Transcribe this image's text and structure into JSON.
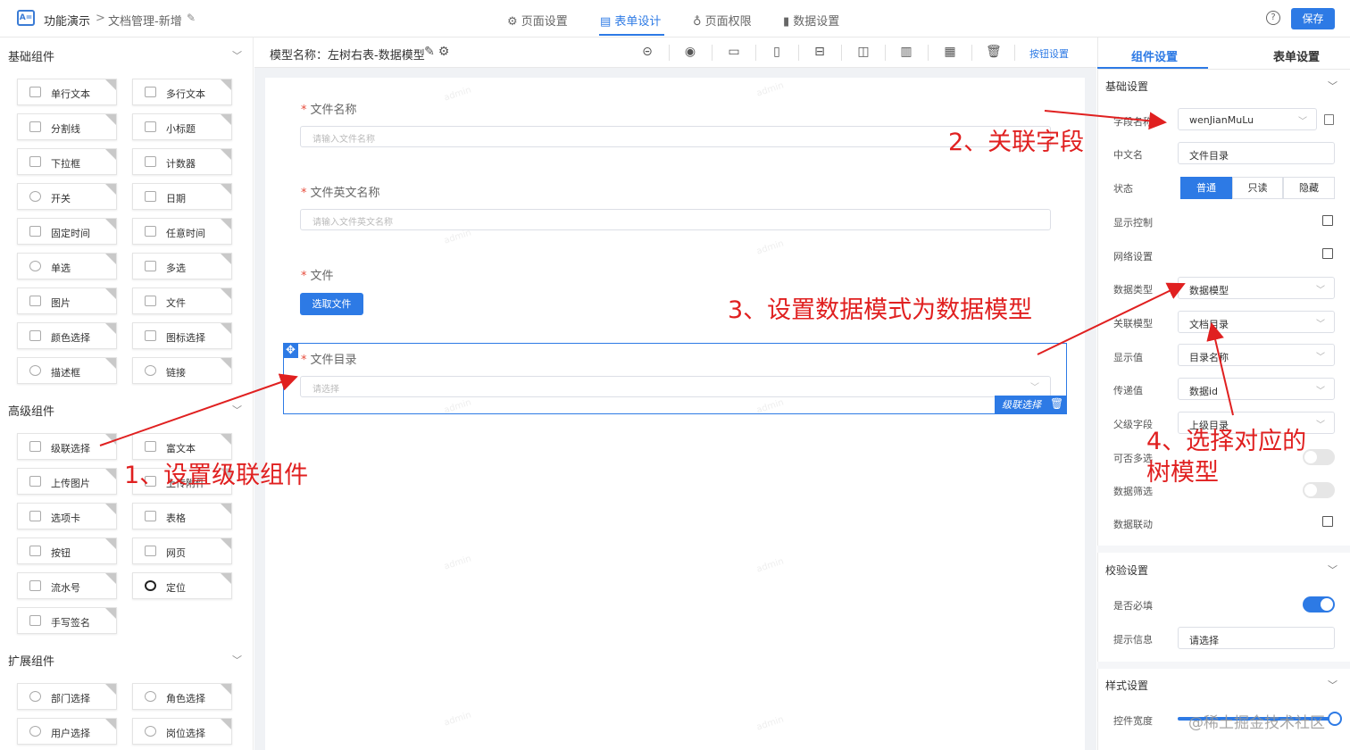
{
  "header": {
    "crumb_root": "功能演示",
    "crumb_sep": ">",
    "crumb_current": "文档管理-新增",
    "tabs": [
      "页面设置",
      "表单设计",
      "页面权限",
      "数据设置"
    ],
    "help": "?",
    "save_label": "保存"
  },
  "left": {
    "basic_title": "基础组件",
    "advanced_title": "高级组件",
    "extended_title": "扩展组件",
    "basic": [
      "单行文本",
      "多行文本",
      "分割线",
      "小标题",
      "下拉框",
      "计数器",
      "开关",
      "日期",
      "固定时间",
      "任意时间",
      "单选",
      "多选",
      "图片",
      "文件",
      "颜色选择",
      "图标选择",
      "描述框",
      "链接"
    ],
    "advanced": [
      "级联选择",
      "富文本",
      "上传图片",
      "上传附件",
      "选项卡",
      "表格",
      "按钮",
      "网页",
      "流水号",
      "定位",
      "手写签名"
    ],
    "extended": [
      "部门选择",
      "角色选择",
      "用户选择",
      "岗位选择"
    ]
  },
  "toolbar": {
    "model_name": "模型名称：左树右表-数据模型",
    "button_settings": "按钮设置"
  },
  "form": {
    "field1_label": "文件名称",
    "field1_placeholder": "请输入文件名称",
    "field2_label": "文件英文名称",
    "field2_placeholder": "请输入文件英文名称",
    "field3_label": "文件",
    "choose_file": "选取文件",
    "field4_label": "文件目录",
    "field4_placeholder": "请选择",
    "selected_tag": "级联选择",
    "required_mark": "*",
    "watermark": "admin"
  },
  "right": {
    "tab_component": "组件设置",
    "tab_form": "表单设置",
    "basic_section": "基础设置",
    "field_name_label": "字段名称",
    "field_name_value": "wenJianMuLu",
    "cn_name_label": "中文名",
    "cn_name_value": "文件目录",
    "status_label": "状态",
    "status_options": [
      "普通",
      "只读",
      "隐藏"
    ],
    "display_control_label": "显示控制",
    "network_label": "网络设置",
    "data_type_label": "数据类型",
    "data_type_value": "数据模型",
    "rel_model_label": "关联模型",
    "rel_model_value": "文档目录",
    "display_value_label": "显示值",
    "display_value_value": "目录名称",
    "pass_value_label": "传递值",
    "pass_value_value": "数据id",
    "parent_field_label": "父级字段",
    "parent_field_value": "上级目录",
    "multi_label": "可否多选",
    "filter_label": "数据筛选",
    "linkage_label": "数据联动",
    "validation_section": "校验设置",
    "required_label": "是否必填",
    "required_on": true,
    "hint_label": "提示信息",
    "hint_value": "请选择",
    "style_section": "样式设置",
    "width_label": "控件宽度",
    "width_percent": 100
  },
  "annotations": {
    "step1": "1、设置级联组件",
    "step2": "2、关联字段",
    "step3": "3、设置数据模式为数据模型",
    "step4_line1": "4、选择对应的",
    "step4_line2": "树模型",
    "site_watermark": "@稀土掘金技术社区"
  },
  "colors": {
    "accent": "#2d7ae5",
    "annotation": "#e02020"
  }
}
